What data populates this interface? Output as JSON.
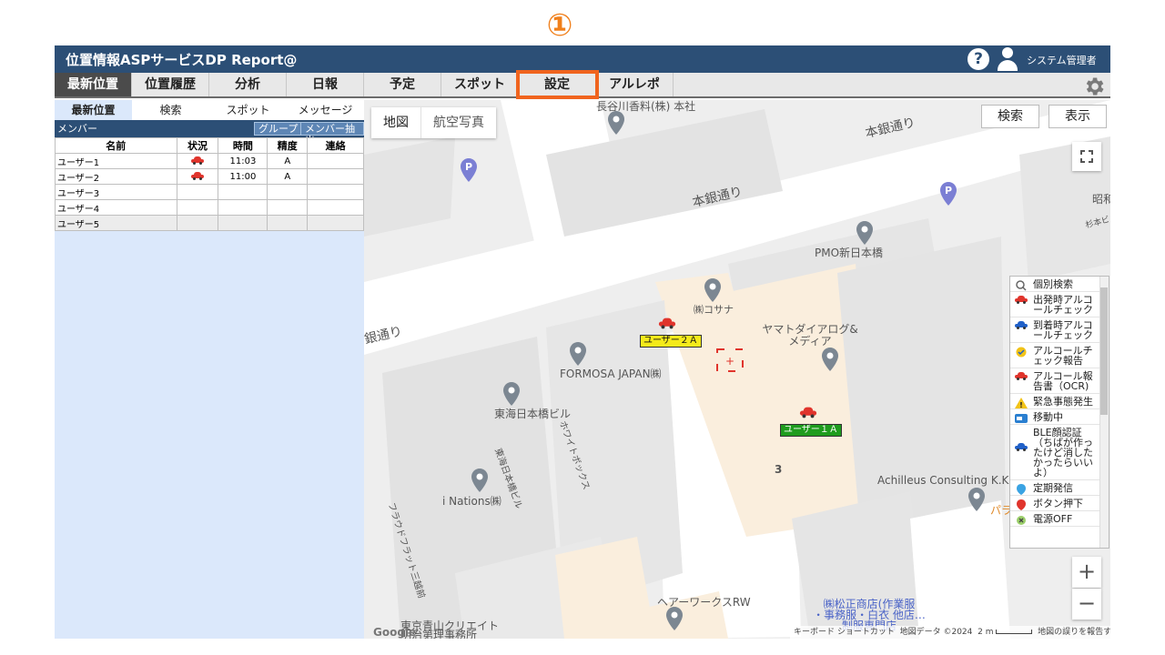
{
  "callout": "①",
  "titlebar": {
    "title": "位置情報ASPサービスDP Report@",
    "help": "?",
    "user": "システム管理者"
  },
  "main_tabs": [
    "最新位置",
    "位置履歴",
    "分析",
    "日報",
    "予定",
    "スポット",
    "設定",
    "アルレポ"
  ],
  "sub_tabs": [
    "最新位置",
    "検索",
    "スポット",
    "メッセージ"
  ],
  "member_bar": {
    "label": "メンバー",
    "group_button": "グループ",
    "extract_button": "メンバー抽出"
  },
  "member_table": {
    "headers": [
      "名前",
      "状況",
      "時間",
      "精度",
      "連絡"
    ],
    "rows": [
      {
        "name": "ユーザー1",
        "status": "car",
        "time": "11:03",
        "accuracy": "A",
        "contact": ""
      },
      {
        "name": "ユーザー2",
        "status": "car",
        "time": "11:00",
        "accuracy": "A",
        "contact": ""
      },
      {
        "name": "ユーザー3",
        "status": "",
        "time": "",
        "accuracy": "",
        "contact": ""
      },
      {
        "name": "ユーザー4",
        "status": "",
        "time": "",
        "accuracy": "",
        "contact": ""
      },
      {
        "name": "ユーザー5",
        "status": "",
        "time": "",
        "accuracy": "",
        "contact": ""
      }
    ]
  },
  "map": {
    "type_map": "地図",
    "type_satellite": "航空写真",
    "search_button": "検索",
    "display_button": "表示",
    "zoom_in": "+",
    "zoom_out": "−",
    "labels": {
      "hasegawa": "長谷川香料(株) 本社",
      "road_top_right": "本銀通り",
      "road_center": "本銀通り",
      "road_left": "銀通り",
      "showa": "昭和",
      "sugimoto": "杉本ビル",
      "pmo": "PMO新日本橋",
      "kosana": "㈱コサナ",
      "yamato": "ヤマトダイアログ&\nメディア",
      "formosa": "FORMOSA JAPAN㈱",
      "tokai": "東海日本橋ビル",
      "whitebox": "ホワイトボックス",
      "tokai_vertical": "東海日本橋ビル",
      "inations": "i Nations㈱",
      "frandflat": "フラウドフラット三越前",
      "achilleus": "Achilleus Consulting K.K",
      "para": "パラ",
      "hairworks": "ヘアーワークスRW",
      "matsumasa": "㈱松正商店(作業服\n・事務服・白衣 他店…\n制服専門店",
      "aoyama": "東京青山クリエイト\n明治第理事務所",
      "three": "3"
    },
    "user2_label": "ユーザー２Ａ",
    "user1_label": "ユーザー１Ａ",
    "footer_google": "Google",
    "footer_keyboard": "キーボード ショートカット",
    "footer_mapdata": "地図データ ©2024",
    "footer_scale": "2 m",
    "footer_report": "地図の誤りを報告する"
  },
  "legend": [
    {
      "icon": "personal-search",
      "label": "個別検索"
    },
    {
      "icon": "car-red",
      "label": "出発時アルコールチェック"
    },
    {
      "icon": "car-blue",
      "label": "到着時アルコールチェック"
    },
    {
      "icon": "check-yellow",
      "label": "アルコールチェック報告"
    },
    {
      "icon": "car-red",
      "label": "アルコール報告書（OCR)"
    },
    {
      "icon": "warning",
      "label": "緊急事態発生"
    },
    {
      "icon": "truck-blue",
      "label": "移動中"
    },
    {
      "icon": "car-blue",
      "label": "BLE顔認証（ちばが作ったけど消したかったらいいよ）"
    },
    {
      "icon": "pin-blue",
      "label": "定期発信"
    },
    {
      "icon": "pin-red",
      "label": "ボタン押下"
    },
    {
      "icon": "power-off",
      "label": "電源OFF"
    }
  ],
  "colors": {
    "header": "#2c4f76",
    "highlight": "#f0641e",
    "sidebar": "#dbe8fb",
    "user1_label": "#1e9c1e",
    "user2_label": "#f5ea1a"
  }
}
